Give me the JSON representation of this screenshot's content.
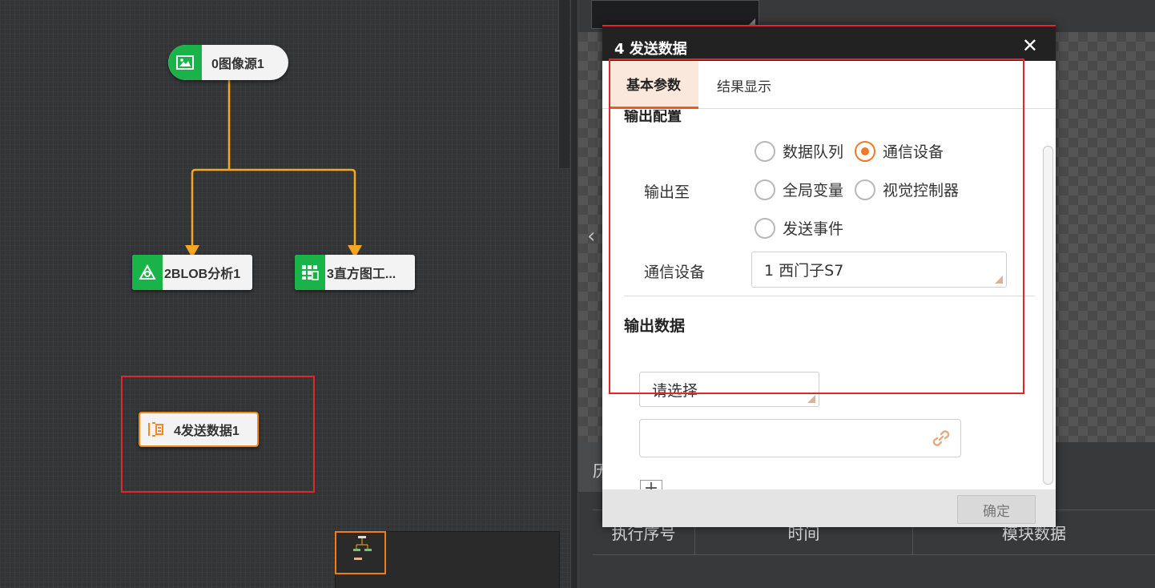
{
  "canvas": {
    "nodes": {
      "source": "0图像源1",
      "blob": "2BLOB分析1",
      "histogram": "3直方图工...",
      "send": "4发送数据1"
    }
  },
  "right_panel": {
    "bottom_tab_char": "历",
    "table_headers": [
      "执行序号",
      "时间",
      "模块数据"
    ]
  },
  "dialog": {
    "title": "4 发送数据",
    "close_glyph": "✕",
    "tabs": [
      "基本参数",
      "结果显示"
    ],
    "active_tab": "基本参数",
    "section_cut_heading": "输出配置",
    "output_to_label": "输出至",
    "output_options": [
      {
        "label": "数据队列",
        "selected": false
      },
      {
        "label": "通信设备",
        "selected": true
      },
      {
        "label": "全局变量",
        "selected": false
      },
      {
        "label": "视觉控制器",
        "selected": false
      },
      {
        "label": "发送事件",
        "selected": false
      }
    ],
    "comm_device_label": "通信设备",
    "comm_device_value": "1 西门子S7",
    "output_data_heading": "输出数据",
    "output_data_select": "请选择",
    "output_data_input": "",
    "add_glyph": "+",
    "ok_label": "确定"
  },
  "colors": {
    "accent": "#ef7a25",
    "node_green": "#19b34a",
    "highlight_red": "#e3262d",
    "connector": "#f5a623"
  }
}
